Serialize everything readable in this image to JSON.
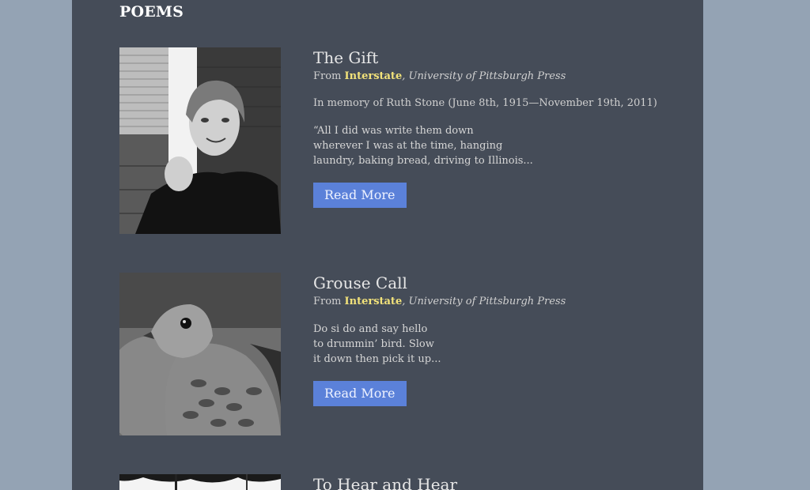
{
  "section_title": "POEMS",
  "poems": [
    {
      "title": "The Gift",
      "source_prefix": "From ",
      "book": "Interstate",
      "press": ", University of Pittsburgh Press",
      "memoriam": "In memory of Ruth Stone (June 8th, 1915—November 19th, 2011)",
      "excerpt_lines": [
        "“All I did was write them down",
        "wherever I was at the time, hanging",
        "laundry, baking bread, driving to Illinois..."
      ],
      "read_more": "Read More"
    },
    {
      "title": "Grouse Call",
      "source_prefix": "From ",
      "book": "Interstate",
      "press": ", University of Pittsburgh Press",
      "excerpt_lines": [
        "Do si do and say hello",
        "to drummin’ bird. Slow",
        "it down then pick it up..."
      ],
      "read_more": "Read More"
    },
    {
      "title": "To Hear and Hear"
    }
  ],
  "colors": {
    "page_bg": "#94a3b4",
    "panel_bg": "#454c58",
    "book_highlight": "#f2e27a",
    "button_bg": "#5b81d9"
  }
}
